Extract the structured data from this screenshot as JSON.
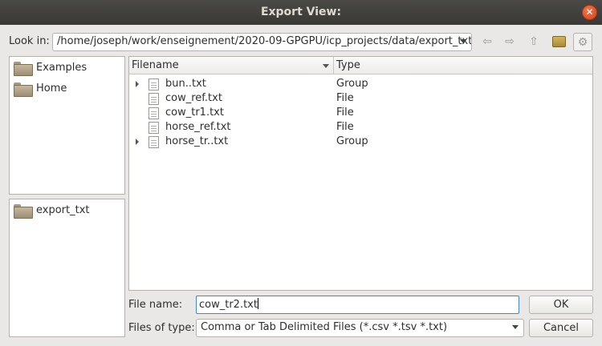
{
  "window": {
    "title": "Export View:"
  },
  "look_in": {
    "label": "Look in:",
    "path": "/home/joseph/work/enseignement/2020-09-GPGPU/icp_projects/data/export_txt/"
  },
  "toolbar": {
    "icons": [
      "back-icon",
      "forward-icon",
      "parent-dir-icon",
      "new-folder-icon",
      "settings-icon"
    ]
  },
  "sidebar": {
    "places": [
      {
        "label": "Examples"
      },
      {
        "label": "Home"
      }
    ],
    "history": [
      {
        "label": "export_txt"
      }
    ]
  },
  "file_list": {
    "columns": {
      "name": "Filename",
      "type": "Type"
    },
    "rows": [
      {
        "name": "bun..txt",
        "type": "Group",
        "expandable": true
      },
      {
        "name": "cow_ref.txt",
        "type": "File",
        "expandable": false
      },
      {
        "name": "cow_tr1.txt",
        "type": "File",
        "expandable": false
      },
      {
        "name": "horse_ref.txt",
        "type": "File",
        "expandable": false
      },
      {
        "name": "horse_tr..txt",
        "type": "Group",
        "expandable": true
      }
    ]
  },
  "file_name": {
    "label": "File name:",
    "value": "cow_tr2.txt"
  },
  "file_type": {
    "label": "Files of type:",
    "value": "Comma or Tab Delimited Files (*.csv *.tsv *.txt)"
  },
  "buttons": {
    "ok": "OK",
    "cancel": "Cancel"
  },
  "colors": {
    "titlebar": "#3f3e3a",
    "close": "#e4572a",
    "focus": "#3b8ad6"
  }
}
